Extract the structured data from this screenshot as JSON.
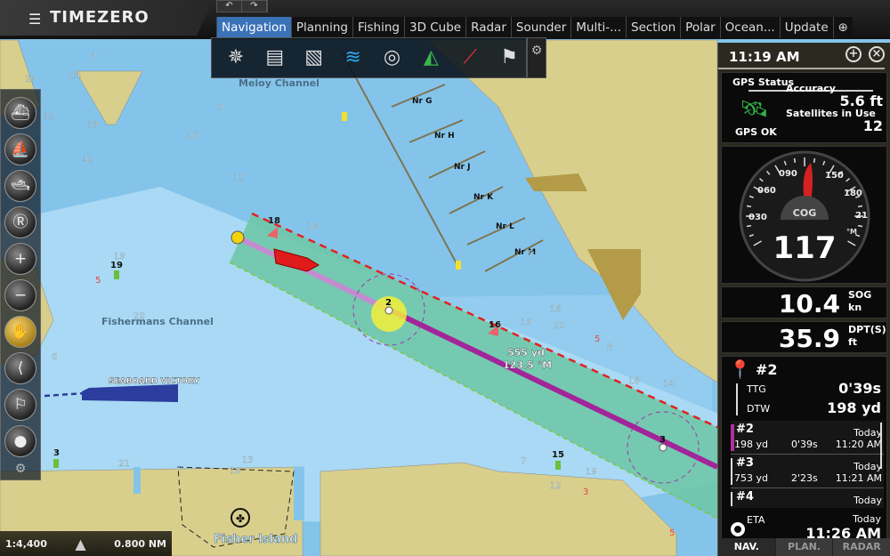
{
  "app": {
    "title": "TIMEZERO",
    "menu_icon": "hamburger-icon"
  },
  "toolbar": {
    "undo_icon": "undo-icon",
    "redo_icon": "redo-icon"
  },
  "tabs": [
    {
      "label": "Navigation",
      "active": true
    },
    {
      "label": "Planning"
    },
    {
      "label": "Fishing"
    },
    {
      "label": "3D Cube"
    },
    {
      "label": "Radar"
    },
    {
      "label": "Sounder"
    },
    {
      "label": "Multi-..."
    },
    {
      "label": "Section"
    },
    {
      "label": "Polar"
    },
    {
      "label": "Ocean..."
    },
    {
      "label": "Update"
    }
  ],
  "ribbon": {
    "icons": [
      "compass-rose-icon",
      "layers-icon",
      "chart-icon",
      "ais-target-icon",
      "radar-icon",
      "route-icon",
      "tide-icon",
      "markers-icon"
    ]
  },
  "left_toolbar": {
    "icons": [
      "boat-centered-icon",
      "boat-follow-icon",
      "boat-3d-icon",
      "reset-icon",
      "zoom-in-icon",
      "zoom-out-icon",
      "pan-hand-icon",
      "measure-icon",
      "mob-icon",
      "event-icon"
    ],
    "active": "pan-hand-icon"
  },
  "scale": {
    "ratio": "1:4,400",
    "range": "0.800 NM"
  },
  "map": {
    "labels": {
      "meloy": "Meloy Channel",
      "fishermans": "Fishermans Channel",
      "fisher_island": "Fisher Island",
      "vessel": "SEABOARD VICTORY",
      "distance": "555 yd",
      "bearing": "123.5 °M"
    },
    "piers": [
      "Nr G",
      "Nr H",
      "Nr J",
      "Nr K",
      "Nr L",
      "Nr M"
    ],
    "waypoints": [
      "2",
      "3"
    ],
    "buoys": [
      "18",
      "16",
      "19",
      "3",
      "15"
    ],
    "depths": [
      "29",
      "24",
      "7",
      "32",
      "33",
      "42",
      "9",
      "16",
      "12",
      "18",
      "19",
      "5",
      "20",
      "6",
      "16",
      "9",
      "18",
      "19",
      "20",
      "8",
      "5",
      "18",
      "14",
      "13",
      "18",
      "7",
      "12",
      "19",
      "21",
      "5",
      "3",
      "5"
    ],
    "colors": {
      "route": "#a3259a",
      "corridor": "#6fc6a8",
      "xte": "#e22222",
      "land": "#d9cf8c",
      "water": "#84c4ea",
      "shallow": "#a9d9f4"
    }
  },
  "panel": {
    "time": "11:19 AM",
    "gps": {
      "title": "GPS Status",
      "status": "GPS OK",
      "accuracy_label": "Accuracy",
      "accuracy": "5.6 ft",
      "sats_label": "Satellites in Use",
      "sats": "12"
    },
    "cog": {
      "label": "COG",
      "value": "117",
      "unit": "°M",
      "ticks": [
        "030",
        "060",
        "090",
        "150",
        "180",
        "21"
      ]
    },
    "sog": {
      "value": "10.4",
      "label": "SOG",
      "unit": "kn"
    },
    "depth": {
      "value": "35.9",
      "label": "DPT(S)",
      "unit": "ft"
    },
    "route": {
      "waypoint": "#2",
      "ttg_label": "TTG",
      "ttg": "0'39s",
      "dtw_label": "DTW",
      "dtw": "198 yd",
      "legs": [
        {
          "name": "#2",
          "dist": "198 yd",
          "time": "0'39s",
          "day": "Today",
          "eta": "11:20 AM"
        },
        {
          "name": "#3",
          "dist": "753 yd",
          "time": "2'23s",
          "day": "Today",
          "eta": "11:21 AM"
        },
        {
          "name": "#4",
          "dist": "",
          "time": "",
          "day": "Today",
          "eta": ""
        }
      ],
      "eta_label": "ETA",
      "eta_day": "Today",
      "eta": "11:26 AM"
    },
    "tabs": [
      {
        "label": "NAV.",
        "active": true
      },
      {
        "label": "PLAN."
      },
      {
        "label": "RADAR"
      }
    ]
  }
}
